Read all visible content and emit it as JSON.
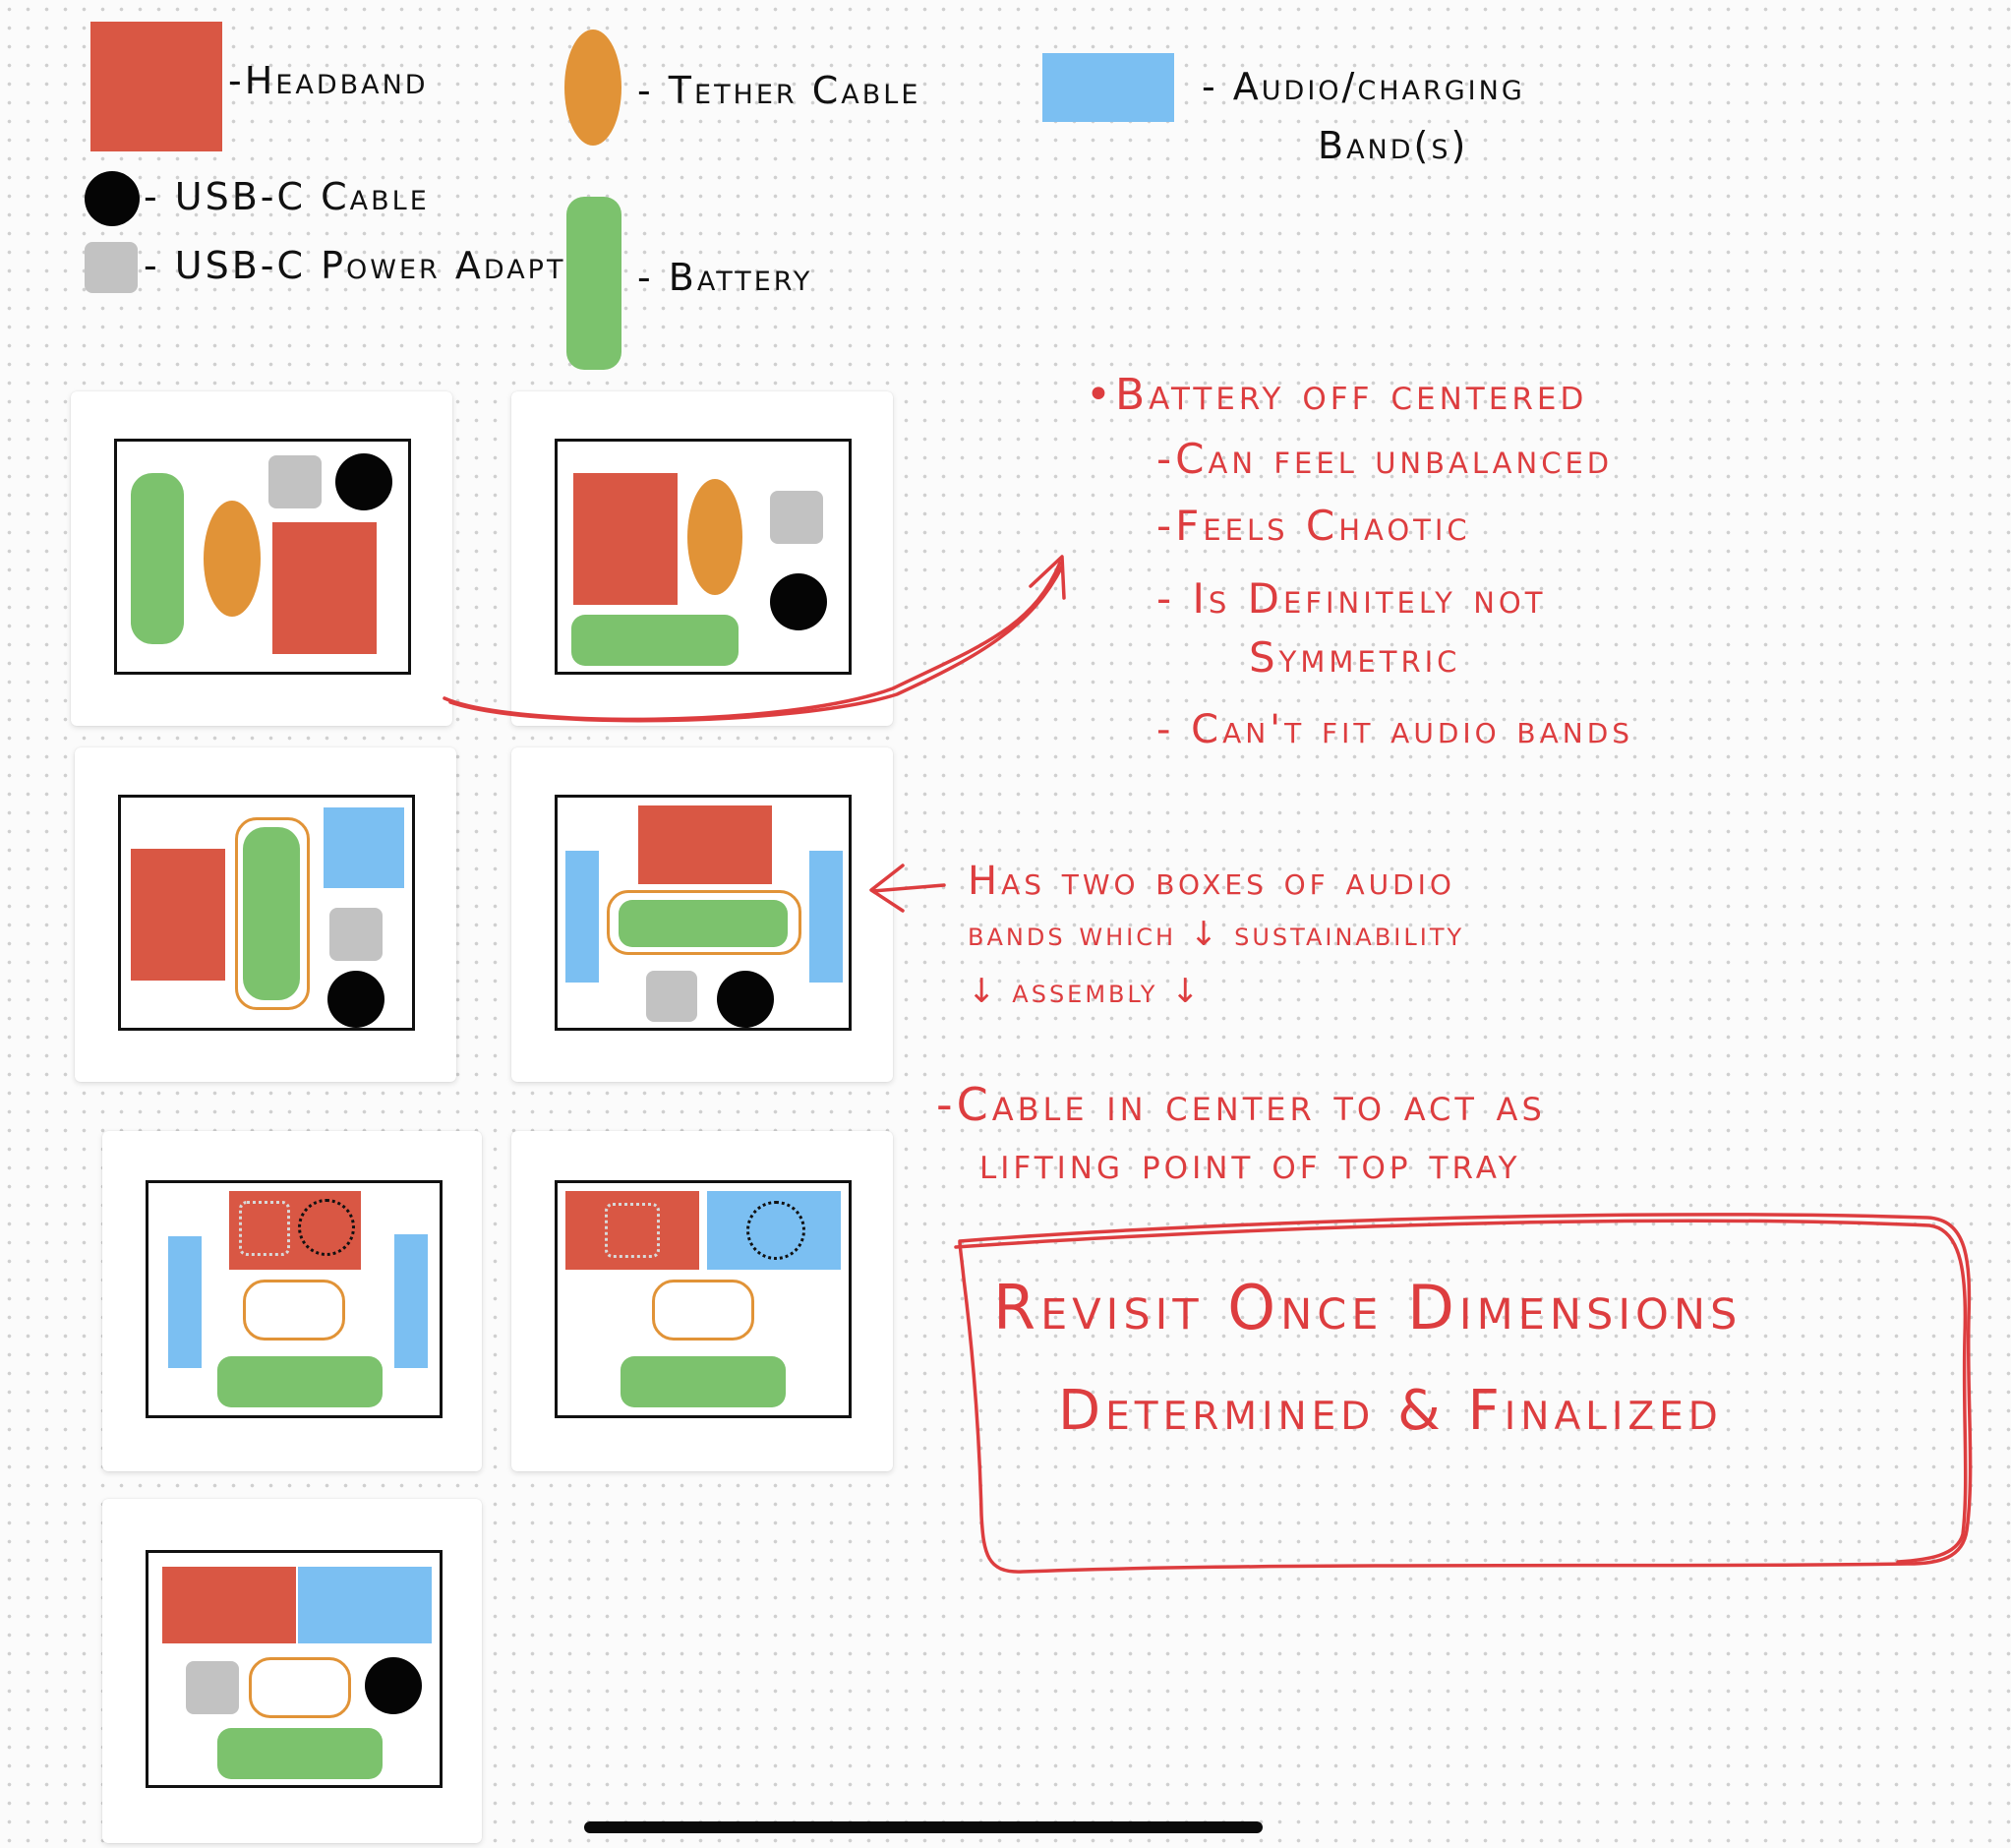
{
  "legend": {
    "headband": "-Headband",
    "usb_cable": "- USB-C Cable",
    "power_adapter": "- USB-C Power Adapter",
    "tether_cable": "- Tether Cable",
    "battery": "- Battery",
    "audio_band_line1": "- Audio/charging",
    "audio_band_line2": "Band(s)"
  },
  "notes": {
    "arrow_note": [
      "•Battery off centered",
      "-Can feel unbalanced",
      "-Feels Chaotic",
      "- Is Definitely not",
      "Symmetric",
      "- Can't fit audio bands"
    ],
    "two_boxes_note": [
      "Has two boxes of audio",
      "bands which ↓ sustainability",
      "↓ assembly ↓"
    ],
    "cable_center_note": [
      "-Cable in center to act as",
      "lifting point of top tray"
    ],
    "revisit_box": [
      "Revisit Once Dimensions",
      "Determined & Finalized"
    ]
  },
  "colors": {
    "headband": "#d95744",
    "usb_cable": "#050505",
    "power_adapter": "#c2c2c2",
    "tether_cable": "#e19337",
    "battery": "#7cc26d",
    "audio_band": "#7bbff2",
    "annotation": "#dd3d3f"
  },
  "layouts_count": 7
}
